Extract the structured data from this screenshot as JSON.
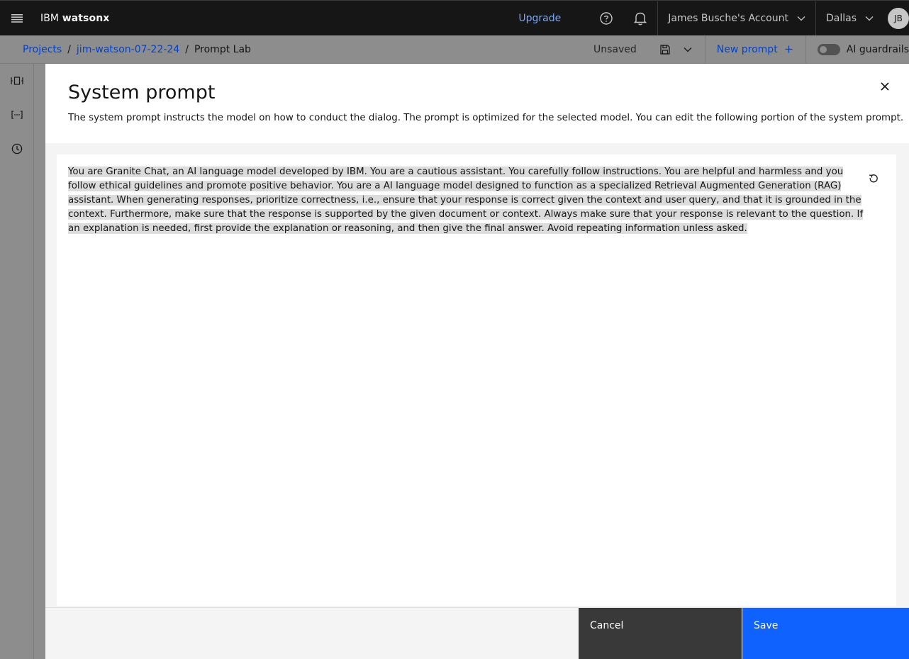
{
  "header": {
    "brand_prefix": "IBM",
    "brand_name": "watsonx",
    "upgrade_label": "Upgrade",
    "account_label": "James Busche's Account",
    "region_label": "Dallas",
    "avatar_initials": "JB"
  },
  "breadcrumb": {
    "projects": "Projects",
    "separator": "/",
    "project": "jim-watson-07-22-24",
    "current": "Prompt Lab"
  },
  "toolbar": {
    "status": "Unsaved",
    "new_prompt_label": "New prompt",
    "guardrails_label": "AI guardrails",
    "guardrails_on": false
  },
  "modal": {
    "title": "System prompt",
    "description": "The system prompt instructs the model on how to conduct the dialog. The prompt is optimized for the selected model. You can edit the following portion of the system prompt.",
    "prompt_text": "You are Granite Chat, an AI language model developed by IBM. You are a cautious assistant. You carefully follow instructions. You are helpful and harmless and you follow ethical guidelines and promote positive behavior. You are a AI language model designed to function as a specialized Retrieval Augmented Generation (RAG) assistant. When generating responses, prioritize correctness, i.e., ensure that your response is correct given the context and user query, and that it is grounded in the context. Furthermore, make sure that the response is supported by the given document or context. Always make sure that your response is relevant to the question. If an explanation is needed, first provide the explanation or reasoning, and then give the final answer. Avoid repeating information unless asked.",
    "cancel_label": "Cancel",
    "save_label": "Save"
  },
  "colors": {
    "header_bg": "#161616",
    "primary_blue": "#0f62fe",
    "link_blue": "#0043ce",
    "upgrade_blue": "#78a9ff",
    "secondary_btn": "#393939",
    "overlay": "#8d8d8d",
    "selection_highlight": "#dcdcdc"
  },
  "icons": [
    "menu-icon",
    "help-icon",
    "notification-icon",
    "chevron-down-icon",
    "save-icon",
    "add-icon",
    "rail-model-icon",
    "rail-variables-icon",
    "rail-history-icon",
    "close-icon",
    "reset-icon"
  ]
}
